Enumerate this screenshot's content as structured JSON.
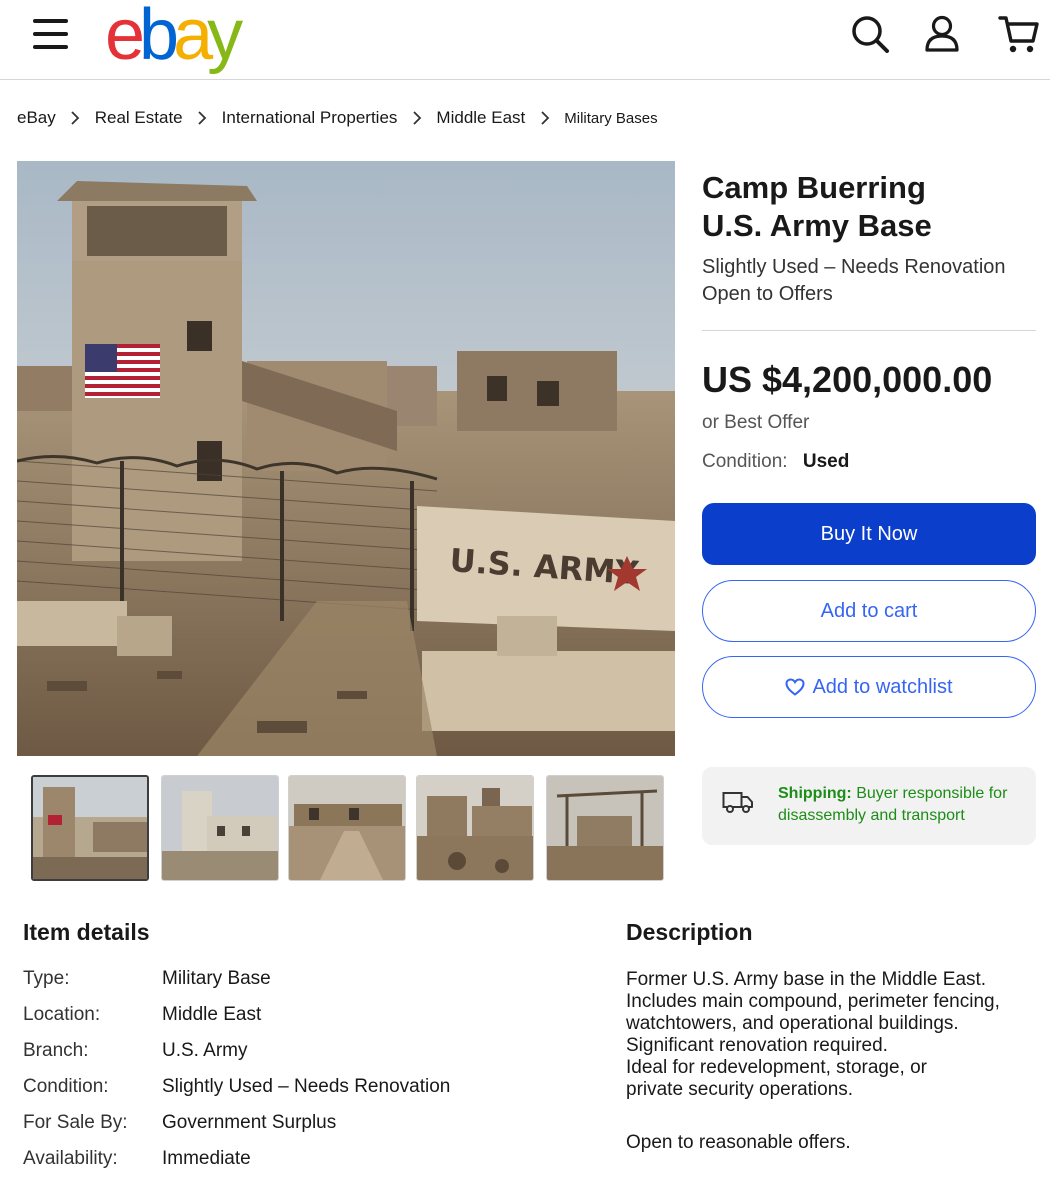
{
  "header": {
    "logo_letters": [
      {
        "char": "e",
        "color": "#e53238"
      },
      {
        "char": "b",
        "color": "#0064d2"
      },
      {
        "char": "a",
        "color": "#f5af02"
      },
      {
        "char": "y",
        "color": "#86b817"
      }
    ],
    "icons": [
      "menu-icon",
      "search-icon",
      "account-icon",
      "cart-icon"
    ]
  },
  "breadcrumb": [
    "eBay",
    "Real Estate",
    "International Properties",
    "Middle East",
    "Military Bases"
  ],
  "listing": {
    "title_line1": "Camp Buerring",
    "title_line2": "U.S. Army Base",
    "subtitle_line1": "Slightly Used – Needs Renovation",
    "subtitle_line2": "Open to Offers",
    "price": "US $4,200,000.00",
    "best_offer": "or Best Offer",
    "condition_label": "Condition:",
    "condition_value": "Used",
    "buy_now": "Buy It Now",
    "add_to_cart": "Add to cart",
    "add_to_watchlist": "Add to watchlist",
    "shipping_label": "Shipping:",
    "shipping_text": "Buyer responsible for disassembly and transport",
    "image_sign_text": "U.S. ARMY"
  },
  "colors": {
    "primary_button": "#0a3ecb",
    "link_blue": "#3665f3",
    "shipping_green": "#1c8d16"
  },
  "thumbnail_count": 5,
  "item_details": {
    "heading": "Item details",
    "rows": [
      {
        "key": "Type:",
        "value": "Military Base"
      },
      {
        "key": "Location:",
        "value": "Middle East"
      },
      {
        "key": "Branch:",
        "value": "U.S. Army"
      },
      {
        "key": "Condition:",
        "value": "Slightly Used – Needs Renovation"
      },
      {
        "key": "For Sale By:",
        "value": "Government Surplus"
      },
      {
        "key": "Availability:",
        "value": "Immediate"
      }
    ]
  },
  "description": {
    "heading": "Description",
    "lines": [
      "Former U.S. Army base in the Middle East.",
      "Includes main compound, perimeter fencing,",
      "watchtowers, and operational buildings.",
      "Significant renovation required.",
      "Ideal for redevelopment, storage, or",
      "private security operations."
    ],
    "closing": "Open to reasonable offers."
  }
}
